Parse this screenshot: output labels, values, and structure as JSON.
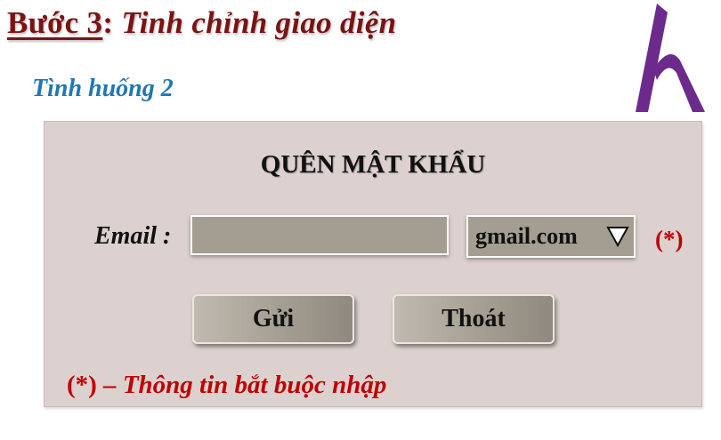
{
  "heading": {
    "step": "Bước 3",
    "separator": ": ",
    "title": "Tinh chỉnh giao diện"
  },
  "scenario": "Tình huống 2",
  "form": {
    "title": "QUÊN MẬT KHẨU",
    "email_label": "Email :",
    "email_value": "",
    "domain_selected": "gmail.com",
    "required_mark": "(*)",
    "send_button": "Gửi",
    "exit_button": "Thoát",
    "note_mark": "(*)",
    "note_text": " – Thông tin bắt buộc nhập"
  },
  "colors": {
    "heading": "#7a1414",
    "scenario": "#1f77b4",
    "panel": "#dcd1cf",
    "input": "#a39d92",
    "required": "#c00000",
    "logo": "#6b2a8c"
  },
  "icons": {
    "logo": "h-logo-icon",
    "dropdown": "triangle-down-icon"
  }
}
